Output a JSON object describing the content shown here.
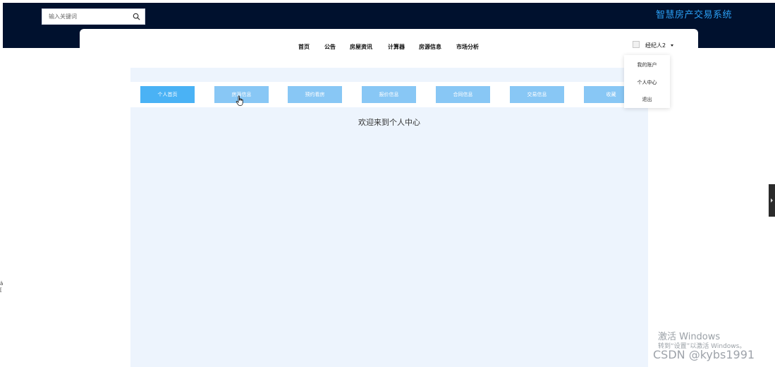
{
  "header": {
    "search_placeholder": "输入关键词",
    "site_title": "智慧房产交易系统"
  },
  "nav": {
    "items": [
      {
        "label": "首页"
      },
      {
        "label": "公告"
      },
      {
        "label": "房屋资讯"
      },
      {
        "label": "计算器"
      },
      {
        "label": "房源信息"
      },
      {
        "label": "市场分析"
      }
    ],
    "user_name": "经纪人2"
  },
  "user_menu": {
    "items": [
      {
        "label": "我的账户"
      },
      {
        "label": "个人中心"
      },
      {
        "label": "退出"
      }
    ]
  },
  "personal_center": {
    "tabs": [
      {
        "label": "个人首页",
        "active": true
      },
      {
        "label": "房源信息"
      },
      {
        "label": "预约看房"
      },
      {
        "label": "报价信息"
      },
      {
        "label": "合同信息"
      },
      {
        "label": "交易信息"
      },
      {
        "label": "收藏"
      }
    ],
    "welcome_text": "欢迎来到个人中心"
  },
  "overlay": {
    "windows_activate_title": "激活 Windows",
    "windows_activate_hint": "转到“设置”以激活 Windows。",
    "csdn_watermark": "CSDN @kybs1991"
  },
  "colors": {
    "header_bg": "#00112e",
    "title_blue": "#2a9ef3",
    "tab_blue": "#88c7f5",
    "tab_active_blue": "#4ab2f5",
    "content_bg": "#edf4fd"
  }
}
